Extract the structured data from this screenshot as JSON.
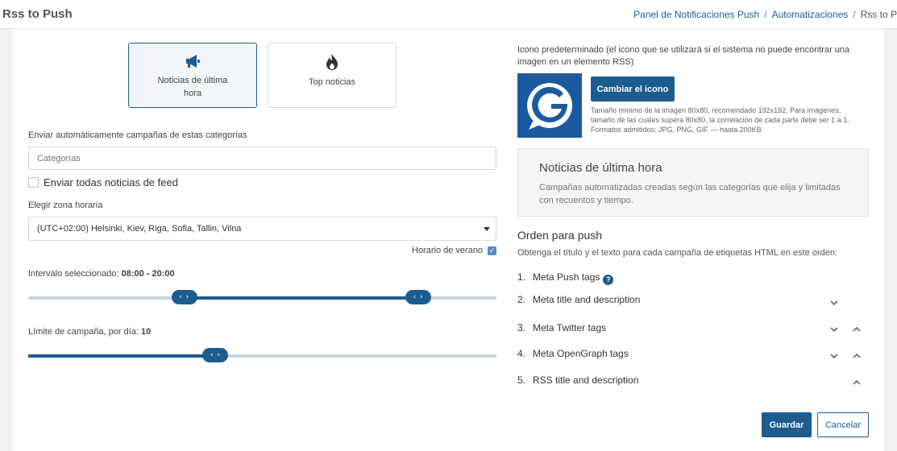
{
  "header": {
    "title": "Rss to Push",
    "breadcrumb": [
      "Panel de Notificaciones Push",
      "Automatizaciones",
      "Rss to P"
    ]
  },
  "left": {
    "tiles": [
      {
        "label": "Noticias de última hora",
        "icon": "megaphone-icon"
      },
      {
        "label": "Top noticias",
        "icon": "fire-icon"
      }
    ],
    "categories_label": "Enviar automáticamente campañas de estas categorías",
    "categories_placeholder": "Categorías",
    "send_all_label": "Enviar todas noticias de feed",
    "timezone_label": "Elegir zona horaria",
    "timezone_value": "(UTC+02:00) Helsinki, Kiev, Riga, Sofia, Tallin, Vilna",
    "dst_label": "Horario de verano",
    "interval_label": "Intervalo seleccionado: ",
    "interval_value": "08:00 - 20:00",
    "interval_range": {
      "min": 0,
      "max": 24,
      "start": 8,
      "end": 20
    },
    "limit_label": "Límite de campaña, por día: ",
    "limit_value": "10",
    "limit_range": {
      "min": 0,
      "max": 25,
      "value": 10
    },
    "handle_glyph": "‹ ›"
  },
  "right": {
    "icon_label": "Icono predeterminado (el icono que se utilizará si el sistema no puede encontrar una imagen en un elemento RSS)",
    "change_icon_button": "Cambiar el icono",
    "help_lines": [
      "Tamaño mínimo de la imágen 80x80, recomendado 192x192. Para imágenes,",
      "tamaño de las cuáles supera 80x80, la correlación de cada parte debe ser 1 a 1.",
      "Formatos admitidos: JPG, PNG, GIF — hasta 200KB"
    ],
    "info_title": "Noticias de última hora",
    "info_desc": "Campañas automatizadas creadas según las categorías que elija y limitadas con recuentos y tiempo.",
    "order_title": "Orden para push",
    "order_sub": "Obtenga el título y el texto para cada campaña de etiquetas HTML en este orden:",
    "order_items": [
      {
        "num": "1.",
        "label": "Meta Push tags"
      },
      {
        "num": "2.",
        "label": "Meta title and description"
      },
      {
        "num": "3.",
        "label": "Meta Twitter tags"
      },
      {
        "num": "4.",
        "label": "Meta OpenGraph tags"
      },
      {
        "num": "5.",
        "label": "RSS title and description"
      }
    ],
    "help_glyph": "?",
    "save_button": "Guardar",
    "cancel_button": "Cancelar"
  },
  "colors": {
    "accent": "#1d5c8f",
    "track": "#c9d4de"
  }
}
